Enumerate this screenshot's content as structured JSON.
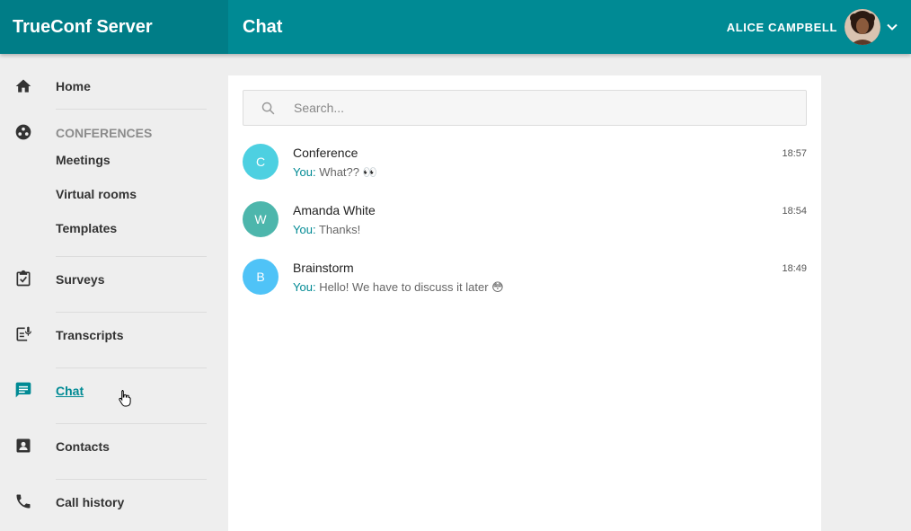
{
  "header": {
    "brand": "TrueConf Server",
    "page_title": "Chat",
    "user_name": "ALICE CAMPBELL"
  },
  "sidebar": {
    "items": [
      {
        "label": "Home",
        "icon": "home-icon"
      },
      {
        "label": "CONFERENCES",
        "icon": "conferences-icon"
      },
      {
        "label": "Meetings"
      },
      {
        "label": "Virtual rooms"
      },
      {
        "label": "Templates"
      },
      {
        "label": "Surveys",
        "icon": "clipboard-check-icon"
      },
      {
        "label": "Transcripts",
        "icon": "transcript-icon"
      },
      {
        "label": "Chat",
        "icon": "chat-icon"
      },
      {
        "label": "Contacts",
        "icon": "contact-card-icon"
      },
      {
        "label": "Call history",
        "icon": "phone-icon"
      }
    ]
  },
  "search": {
    "placeholder": "Search...",
    "value": ""
  },
  "chats": [
    {
      "initial": "C",
      "name": "Conference",
      "you_label": "You:",
      "message": "What?? 👀",
      "time": "18:57",
      "color": "#4dd0e1"
    },
    {
      "initial": "W",
      "name": "Amanda White",
      "you_label": "You:",
      "message": "Thanks!",
      "time": "18:54",
      "color": "#4db6ac"
    },
    {
      "initial": "B",
      "name": "Brainstorm",
      "you_label": "You:",
      "message": "Hello! We have to discuss it later 😳",
      "time": "18:49",
      "color": "#4fc3f7"
    }
  ],
  "colors": {
    "accent": "#008a94",
    "header_dark": "#007d87"
  }
}
